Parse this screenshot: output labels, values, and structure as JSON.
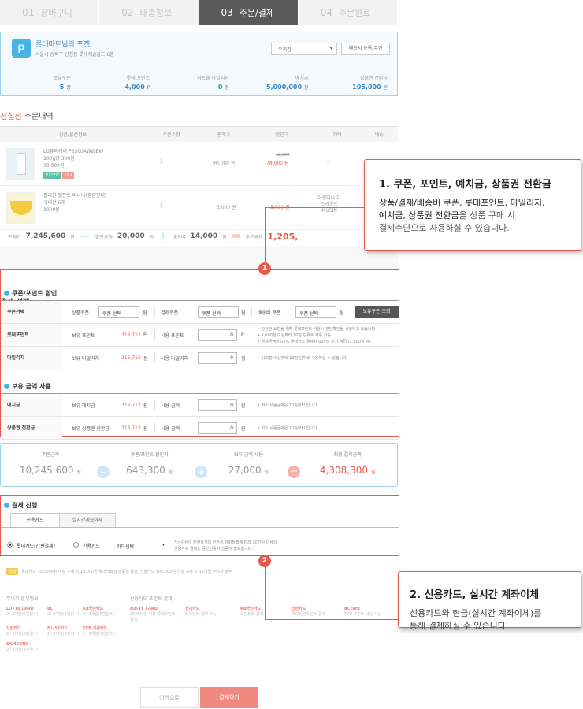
{
  "steps": [
    {
      "num": "01",
      "label": "장바구니"
    },
    {
      "num": "02",
      "label": "배송정보"
    },
    {
      "num": "03",
      "label": "주문/결제"
    },
    {
      "num": "04",
      "label": "주문완료"
    }
  ],
  "wallet": {
    "logo": "p",
    "name": "롯데마트님의 포켓",
    "address": "서울시 송파구 신천동 롯데캐슬골드 6층",
    "select": "우리집",
    "register_btn": "배송지 등록/수정",
    "stats": [
      {
        "label": "보유쿠폰",
        "value": "5",
        "unit": "장"
      },
      {
        "label": "롯데 포인트",
        "value": "4,000",
        "unit": "P"
      },
      {
        "label": "마트몰 마일리지",
        "value": "0",
        "unit": "점"
      },
      {
        "label": "예치금",
        "value": "5,000,000",
        "unit": "원"
      },
      {
        "label": "상품권 전환금",
        "value": "105,000",
        "unit": "원"
      }
    ]
  },
  "order": {
    "shop": "잠실점",
    "title": "주문내역",
    "headers": [
      "상품/옵션정보",
      "주문수량",
      "판매가",
      "할인가",
      "혜택",
      "배송"
    ],
    "items": [
      {
        "name": "LG퓨리케어 PS300AWWBW",
        "line2": "100g당 300원",
        "line3": "30,000원",
        "tag1": "할인쿠폰",
        "tag2": "1+1",
        "qty": "1",
        "price": "90,000 원",
        "orig": "12,000",
        "disc": "78,000 원",
        "benefit": "-"
      },
      {
        "name": "필리핀 델몬트 바나나(중량판매)",
        "line2": "국내산 6개",
        "line3": "1000원",
        "qty": "1",
        "price": "3,000 원",
        "disc": "3,000 원",
        "benefit": "어린이나 디스카운트 MUSIN"
      }
    ]
  },
  "totals": {
    "sale_label": "판매가",
    "sale": "7,245,600",
    "unit": "원",
    "discount_label": "할인금액",
    "discount": "20,000",
    "ship_label": "배송비",
    "ship": "14,000",
    "final_label": "주문금액",
    "final": "1,205,"
  },
  "callout1": {
    "title": "1. 쿠폰, 포인트, 예치금, 상품권 전환금",
    "line1a": "상품/결제/배송비 쿠폰, 롯데포인트, 마일리지,",
    "line2a": "예치금, 상품권 전환금",
    "line2b": "을 상품 구매 시",
    "line3": "결제수단으로 사용하실 수 있습니다."
  },
  "callout2": {
    "title": "2. 신용카드, 실시간 계좌이체",
    "line1": "신용카드와 현금(실시간 계좌이체)를",
    "line2": "통해 결제하실 수 있습니다."
  },
  "badges": {
    "one": "1",
    "two": "2"
  },
  "payment": {
    "title": "결제 선택",
    "sec1": "쿠폰/포인트 할인",
    "coupon_row": {
      "head": "쿠폰선택",
      "product_coupon": "상품쿠폰",
      "sel": "쿠폰 선택",
      "won": "원",
      "pay_coupon": "결제쿠폰",
      "ship_coupon": "배송비 쿠폰",
      "btn": "보유쿠폰 조회"
    },
    "point_row": {
      "head": "롯데포인트",
      "own": "보유 포인트",
      "own_val": "316,712",
      "own_unit": "P",
      "use": "사용 포인트",
      "input": "0",
      "unit": "P",
      "notes": [
        "• 안전한 쇼핑을 위해 롯데포인트 사용시 본인확인을 시행하고 있습니다.",
        "• 1,000점 이상부터 10점 단위로 사용 가능",
        "• 결제금액의 05% 롯데카드 결제시 025% 추가 적립 (1,000점 당)"
      ]
    },
    "mileage_row": {
      "head": "마일리지",
      "own": "보유 마일리지",
      "own_val": "316,712",
      "own_unit": "점",
      "use": "사용 마일리지",
      "input": "0",
      "unit": "점",
      "note": "• 100점 이상부터 10점 단위로 사용하실 수 있습니다."
    },
    "sec2": "보유 금액 사용",
    "deposit_row": {
      "head": "예치금",
      "own": "보유 예치금",
      "own_val": "316,712",
      "own_unit": "원",
      "use": "사용 금액",
      "input": "0",
      "unit": "원",
      "note": "• 최소 사용금액은 10원부터 입니다."
    },
    "voucher_row": {
      "head": "상품권 전환금",
      "own": "보유 상품권 전환금",
      "own_val": "316,712",
      "own_unit": "원",
      "use": "사용 금액",
      "input": "0",
      "unit": "원",
      "note": "• 최소 사용금액은 10원부터 입니다."
    }
  },
  "summary": [
    {
      "label": "주문금액",
      "value": "10,245,600",
      "unit": "원"
    },
    {
      "label": "쿠폰/포인트 할인가",
      "value": "643,300",
      "unit": "원"
    },
    {
      "label": "보유 금액 사용",
      "value": "27,000",
      "unit": "원"
    },
    {
      "label": "최종 결제금액",
      "value": "4,308,300",
      "unit": "원"
    }
  ],
  "progress": {
    "title": "결제 진행",
    "tab1": "신용카드",
    "tab2": "실시간계좌이체",
    "opt1": "롯데카드(간편결제)",
    "opt2": "신용카드",
    "card_select": "카드선택",
    "note1": "* 금감원의 전자상거래 안전성 강화정책에 따라 30만원 이상의",
    "note2": "신용카드 결제는 공인인증서 인증이 필요합니다."
  },
  "info": {
    "label": "해택",
    "text": "롯데카드 300,000원 이상 구매 시 10,000원 롯데백화점 상품권 증정, 신용카드 100,000원 이상 구매 시 12개월 무이자 할부"
  },
  "cards": {
    "left_title": "무이자 할부정보",
    "right_title": "신용카드 포인트 결제",
    "left": [
      {
        "name": "LOTTE CARD",
        "t": "2~3개월(5만원↑)"
      },
      {
        "name": "BC",
        "t": "2~3개월(5만원↑)"
      },
      {
        "name": "KB국민카드",
        "t": "2~3개월(5만원↑)"
      },
      {
        "name": "신한카드",
        "t": "2~3개월(5만원↑)"
      },
      {
        "name": "하나SK카드",
        "t": "2~3개월(5만원↑)"
      },
      {
        "name": "KEB 외환카드",
        "t": "2~3개월(5만원↑)"
      },
      {
        "name": "SAMSUNG",
        "t": "2~3개월(5만원↑)"
      }
    ],
    "right": [
      {
        "name": "LOTTE CARD",
        "t": "10,000원 이상 롯데포인트 결제"
      },
      {
        "name": "현대카드",
        "t": "M포인트 결제 가능"
      },
      {
        "name": "KB국민카드",
        "t": "포인트리 결제"
      },
      {
        "name": "신한카드",
        "t": "마이신한포인트 결제"
      },
      {
        "name": "BCcard",
        "t": "TOP 포인트 사용 가능"
      }
    ]
  },
  "buttons": {
    "prev": "이전으로",
    "pay": "결제하기"
  }
}
